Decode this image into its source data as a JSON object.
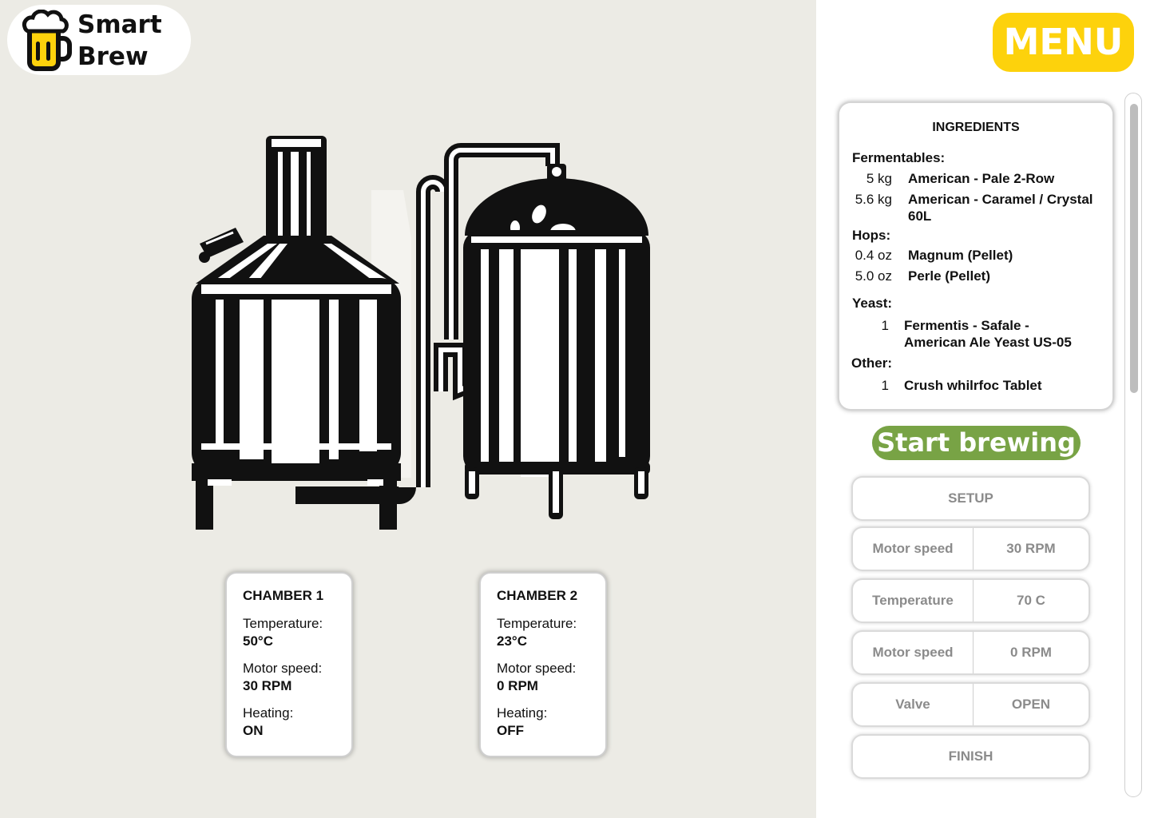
{
  "app": {
    "logo_line1": "Smart",
    "logo_line2": "Brew",
    "menu_label": "MENU"
  },
  "colors": {
    "accent_yellow": "#fdd20c",
    "start_green": "#78a345",
    "left_background": "#ecebe5"
  },
  "chambers": [
    {
      "title": "CHAMBER 1",
      "temperature_label": "Temperature:",
      "temperature_value": "50°C",
      "motor_label": "Motor speed:",
      "motor_value": "30 RPM",
      "heating_label": "Heating:",
      "heating_value": "ON"
    },
    {
      "title": "CHAMBER 2",
      "temperature_label": "Temperature:",
      "temperature_value": "23°C",
      "motor_label": "Motor speed:",
      "motor_value": "0 RPM",
      "heating_label": "Heating:",
      "heating_value": "OFF"
    }
  ],
  "ingredients": {
    "title": "INGREDIENTS",
    "fermentables_label": "Fermentables:",
    "fermentables": [
      {
        "amount": "5 kg",
        "name": "American - Pale 2-Row"
      },
      {
        "amount": "5.6 kg",
        "name_line1": "American - Caramel / Crystal",
        "name_line2": "60L"
      }
    ],
    "hops_label": "Hops:",
    "hops": [
      {
        "amount": "0.4 oz",
        "name": "Magnum (Pellet)"
      },
      {
        "amount": "5.0 oz",
        "name": "Perle (Pellet)"
      }
    ],
    "yeast_label": "Yeast:",
    "yeast": [
      {
        "amount": "1",
        "name_line1": "Fermentis - Safale -",
        "name_line2": "American Ale Yeast US-05"
      }
    ],
    "other_label": "Other:",
    "other": [
      {
        "amount": "1",
        "name": "Crush whilrfoc Tablet"
      }
    ]
  },
  "start_label": "Start brewing",
  "steps": {
    "setup": "SETUP",
    "rows": [
      {
        "label": "Motor speed",
        "value": "30 RPM"
      },
      {
        "label": "Temperature",
        "value": "70 C"
      },
      {
        "label": "Motor speed",
        "value": "0 RPM"
      },
      {
        "label": "Valve",
        "value": "OPEN"
      }
    ],
    "finish": "FINISH"
  },
  "icons": {
    "logo": "beer-mug-icon",
    "illustration": "brewhouse-tanks-illustration"
  }
}
